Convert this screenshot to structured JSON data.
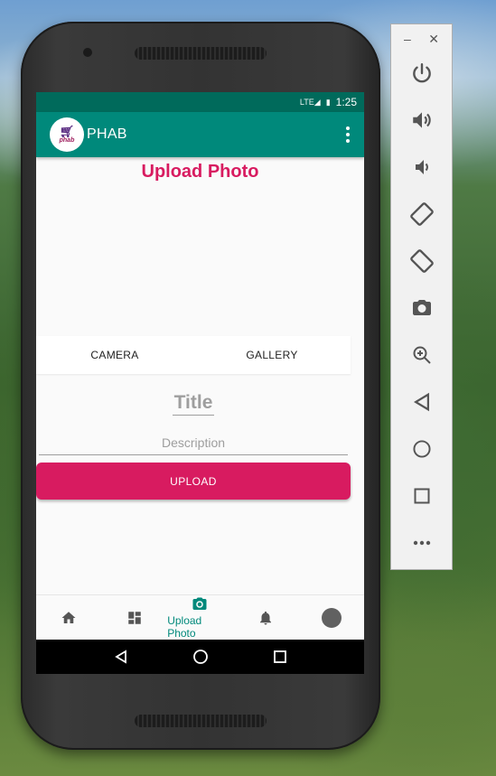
{
  "status_bar": {
    "network": "LTE",
    "time": "1:25"
  },
  "app_bar": {
    "logo_text": "phab",
    "title": "PHAB"
  },
  "page": {
    "title": "Upload Photo"
  },
  "source_buttons": {
    "camera": "CAMERA",
    "gallery": "GALLERY"
  },
  "form": {
    "title_placeholder": "Title",
    "description_placeholder": "Description",
    "upload_label": "UPLOAD"
  },
  "bottom_nav": {
    "items": [
      {
        "icon": "home-icon",
        "label": ""
      },
      {
        "icon": "dashboard-icon",
        "label": ""
      },
      {
        "icon": "camera-icon",
        "label": "Upload Photo"
      },
      {
        "icon": "bell-icon",
        "label": ""
      },
      {
        "icon": "avatar",
        "label": ""
      }
    ]
  },
  "colors": {
    "primary": "#00897b",
    "primary_dark": "#006a5b",
    "accent": "#d81b60"
  },
  "emulator_toolbar": {
    "icons": [
      "power-icon",
      "volume-up-icon",
      "volume-down-icon",
      "rotate-left-icon",
      "rotate-right-icon",
      "screenshot-icon",
      "zoom-icon",
      "back-icon",
      "home-icon",
      "overview-icon",
      "more-icon"
    ]
  }
}
